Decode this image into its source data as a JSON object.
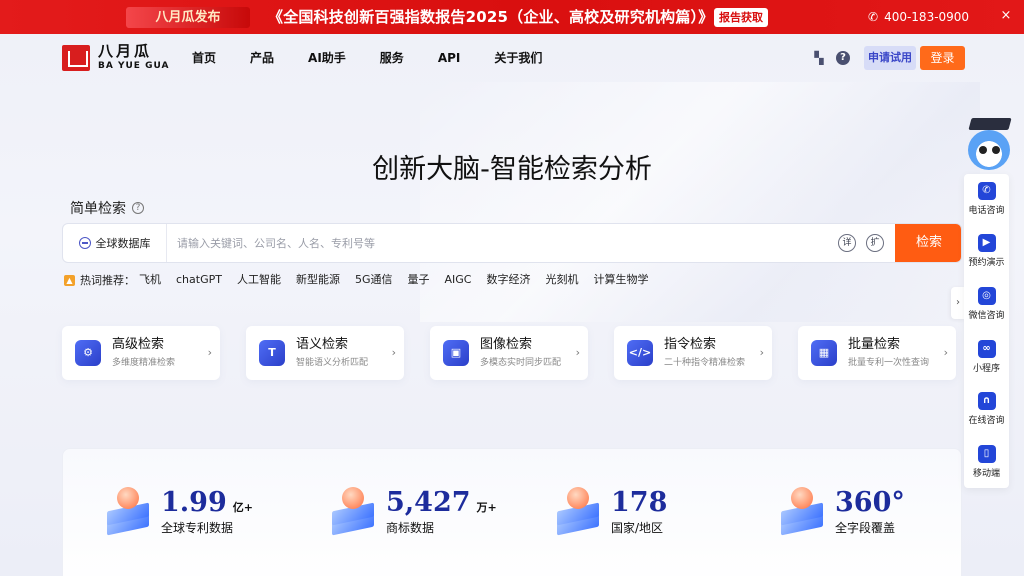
{
  "promo": {
    "brand_badge": "八月瓜发布",
    "headline": "《全国科技创新百强指数报告2025（企业、高校及研究机构篇）》",
    "report_button": "报告获取",
    "phone": "400-183-0900",
    "close_icon": "×"
  },
  "header": {
    "logo_cn": "八月瓜",
    "logo_en": "BA YUE GUA",
    "nav": [
      "首页",
      "产品",
      "AI助手",
      "服务",
      "API",
      "关于我们"
    ],
    "trial_button": "申请试用",
    "login_button": "登录"
  },
  "hero": {
    "title": "创新大脑-智能检索分析",
    "search_label": "简单检索",
    "database_select": "全球数据库",
    "search_placeholder": "请输入关键词、公司名、人名、专利号等",
    "detail_button": "详",
    "expand_button": "扩",
    "search_button": "检索"
  },
  "hot": {
    "lead": "热词推荐：",
    "keywords": [
      "飞机",
      "chatGPT",
      "人工智能",
      "新型能源",
      "5G通信",
      "量子",
      "AIGC",
      "数字经济",
      "光刻机",
      "计算生物学"
    ]
  },
  "cards": [
    {
      "title": "高级检索",
      "sub": "多维度精准检索",
      "icon": "advanced-search-icon"
    },
    {
      "title": "语义检索",
      "sub": "智能语义分析匹配",
      "icon": "semantic-search-icon"
    },
    {
      "title": "图像检索",
      "sub": "多模态实时同步匹配",
      "icon": "image-search-icon"
    },
    {
      "title": "指令检索",
      "sub": "二十种指令精准检索",
      "icon": "command-search-icon"
    },
    {
      "title": "批量检索",
      "sub": "批量专利一次性查询",
      "icon": "batch-search-icon"
    }
  ],
  "stats": [
    {
      "num": "1.99",
      "unit": "亿+",
      "label": "全球专利数据"
    },
    {
      "num": "5,427",
      "unit": "万+",
      "label": "商标数据"
    },
    {
      "num": "178",
      "unit": "",
      "label": "国家/地区"
    },
    {
      "num": "360°",
      "unit": "",
      "label": "全字段覆盖"
    }
  ],
  "sidebar": {
    "items": [
      {
        "label": "电话咨询",
        "icon": "phone-icon"
      },
      {
        "label": "预约演示",
        "icon": "presentation-icon"
      },
      {
        "label": "微信咨询",
        "icon": "wechat-icon"
      },
      {
        "label": "小程序",
        "icon": "mini-program-icon"
      },
      {
        "label": "在线咨询",
        "icon": "headset-icon"
      },
      {
        "label": "移动端",
        "icon": "mobile-icon"
      }
    ]
  },
  "colors": {
    "promo_red": "#e31b1b",
    "accent_orange": "#ff5c12",
    "brand_blue": "#2346d8",
    "stat_blue": "#1d2c9c"
  }
}
